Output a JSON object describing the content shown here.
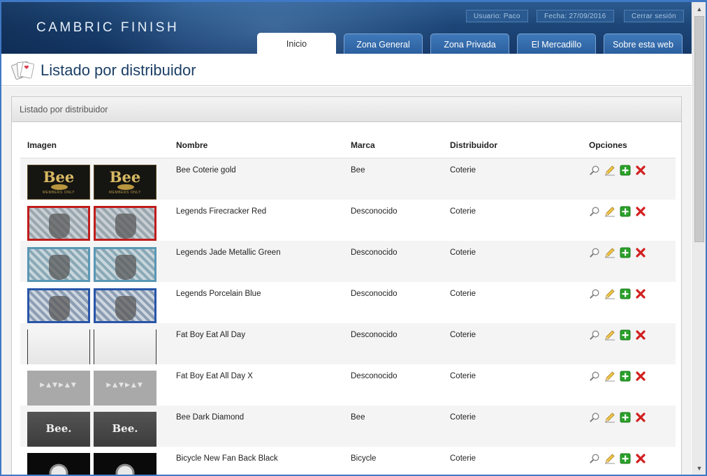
{
  "header": {
    "logo": "CAMBRIC FINISH",
    "user": "Usuario: Paco",
    "date": "Fecha: 27/09/2016",
    "logout": "Cerrar sesión"
  },
  "tabs": [
    {
      "label": "Inicio",
      "active": true
    },
    {
      "label": "Zona General",
      "active": false
    },
    {
      "label": "Zona Privada",
      "active": false
    },
    {
      "label": "El Mercadillo",
      "active": false
    },
    {
      "label": "Sobre esta web",
      "active": false
    }
  ],
  "page": {
    "title": "Listado por distribuidor",
    "panel_title": "Listado por distribuidor"
  },
  "table": {
    "columns": [
      "Imagen",
      "Nombre",
      "Marca",
      "Distribuidor",
      "Opciones"
    ],
    "rows": [
      {
        "name": "Bee Coterie gold",
        "brand": "Bee",
        "distributor": "Coterie",
        "card_label": "Bee",
        "card_sub": "MEMBERS ONLY"
      },
      {
        "name": "Legends Firecracker Red",
        "brand": "Desconocido",
        "distributor": "Coterie"
      },
      {
        "name": "Legends Jade Metallic Green",
        "brand": "Desconocido",
        "distributor": "Coterie"
      },
      {
        "name": "Legends Porcelain Blue",
        "brand": "Desconocido",
        "distributor": "Coterie"
      },
      {
        "name": "Fat Boy Eat All Day",
        "brand": "Desconocido",
        "distributor": "Coterie"
      },
      {
        "name": "Fat Boy Eat All Day X",
        "brand": "Desconocido",
        "distributor": "Coterie",
        "card_label": "▶▲▼▶▲▼"
      },
      {
        "name": "Bee Dark Diamond",
        "brand": "Bee",
        "distributor": "Coterie",
        "card_label": "Bee."
      },
      {
        "name": "Bicycle New Fan Back Black",
        "brand": "Bicycle",
        "distributor": "Coterie"
      }
    ]
  },
  "icons": {
    "view": "magnifier-icon",
    "edit": "pencil-icon",
    "add": "plus-icon",
    "delete": "delete-x-icon"
  },
  "colors": {
    "header_bg": "#1d4677",
    "title_text": "#1c3f66",
    "add_green": "#2aa12a",
    "delete_red": "#d21f1f"
  }
}
